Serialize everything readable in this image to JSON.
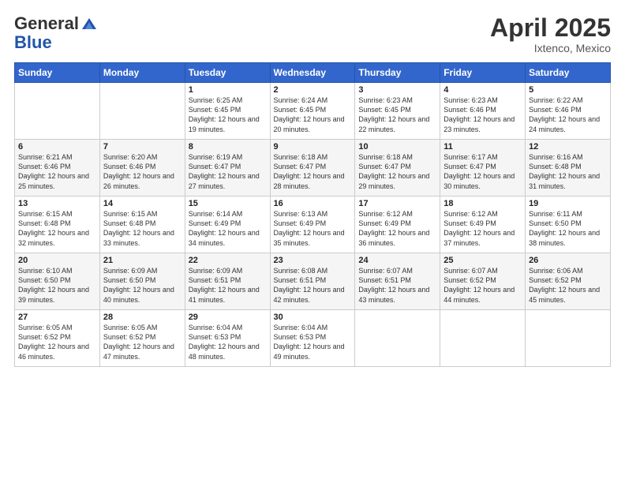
{
  "header": {
    "logo_general": "General",
    "logo_blue": "Blue",
    "title": "April 2025",
    "location": "Ixtenco, Mexico"
  },
  "weekdays": [
    "Sunday",
    "Monday",
    "Tuesday",
    "Wednesday",
    "Thursday",
    "Friday",
    "Saturday"
  ],
  "weeks": [
    [
      {
        "day": "",
        "info": ""
      },
      {
        "day": "",
        "info": ""
      },
      {
        "day": "1",
        "info": "Sunrise: 6:25 AM\nSunset: 6:45 PM\nDaylight: 12 hours and 19 minutes."
      },
      {
        "day": "2",
        "info": "Sunrise: 6:24 AM\nSunset: 6:45 PM\nDaylight: 12 hours and 20 minutes."
      },
      {
        "day": "3",
        "info": "Sunrise: 6:23 AM\nSunset: 6:45 PM\nDaylight: 12 hours and 22 minutes."
      },
      {
        "day": "4",
        "info": "Sunrise: 6:23 AM\nSunset: 6:46 PM\nDaylight: 12 hours and 23 minutes."
      },
      {
        "day": "5",
        "info": "Sunrise: 6:22 AM\nSunset: 6:46 PM\nDaylight: 12 hours and 24 minutes."
      }
    ],
    [
      {
        "day": "6",
        "info": "Sunrise: 6:21 AM\nSunset: 6:46 PM\nDaylight: 12 hours and 25 minutes."
      },
      {
        "day": "7",
        "info": "Sunrise: 6:20 AM\nSunset: 6:46 PM\nDaylight: 12 hours and 26 minutes."
      },
      {
        "day": "8",
        "info": "Sunrise: 6:19 AM\nSunset: 6:47 PM\nDaylight: 12 hours and 27 minutes."
      },
      {
        "day": "9",
        "info": "Sunrise: 6:18 AM\nSunset: 6:47 PM\nDaylight: 12 hours and 28 minutes."
      },
      {
        "day": "10",
        "info": "Sunrise: 6:18 AM\nSunset: 6:47 PM\nDaylight: 12 hours and 29 minutes."
      },
      {
        "day": "11",
        "info": "Sunrise: 6:17 AM\nSunset: 6:47 PM\nDaylight: 12 hours and 30 minutes."
      },
      {
        "day": "12",
        "info": "Sunrise: 6:16 AM\nSunset: 6:48 PM\nDaylight: 12 hours and 31 minutes."
      }
    ],
    [
      {
        "day": "13",
        "info": "Sunrise: 6:15 AM\nSunset: 6:48 PM\nDaylight: 12 hours and 32 minutes."
      },
      {
        "day": "14",
        "info": "Sunrise: 6:15 AM\nSunset: 6:48 PM\nDaylight: 12 hours and 33 minutes."
      },
      {
        "day": "15",
        "info": "Sunrise: 6:14 AM\nSunset: 6:49 PM\nDaylight: 12 hours and 34 minutes."
      },
      {
        "day": "16",
        "info": "Sunrise: 6:13 AM\nSunset: 6:49 PM\nDaylight: 12 hours and 35 minutes."
      },
      {
        "day": "17",
        "info": "Sunrise: 6:12 AM\nSunset: 6:49 PM\nDaylight: 12 hours and 36 minutes."
      },
      {
        "day": "18",
        "info": "Sunrise: 6:12 AM\nSunset: 6:49 PM\nDaylight: 12 hours and 37 minutes."
      },
      {
        "day": "19",
        "info": "Sunrise: 6:11 AM\nSunset: 6:50 PM\nDaylight: 12 hours and 38 minutes."
      }
    ],
    [
      {
        "day": "20",
        "info": "Sunrise: 6:10 AM\nSunset: 6:50 PM\nDaylight: 12 hours and 39 minutes."
      },
      {
        "day": "21",
        "info": "Sunrise: 6:09 AM\nSunset: 6:50 PM\nDaylight: 12 hours and 40 minutes."
      },
      {
        "day": "22",
        "info": "Sunrise: 6:09 AM\nSunset: 6:51 PM\nDaylight: 12 hours and 41 minutes."
      },
      {
        "day": "23",
        "info": "Sunrise: 6:08 AM\nSunset: 6:51 PM\nDaylight: 12 hours and 42 minutes."
      },
      {
        "day": "24",
        "info": "Sunrise: 6:07 AM\nSunset: 6:51 PM\nDaylight: 12 hours and 43 minutes."
      },
      {
        "day": "25",
        "info": "Sunrise: 6:07 AM\nSunset: 6:52 PM\nDaylight: 12 hours and 44 minutes."
      },
      {
        "day": "26",
        "info": "Sunrise: 6:06 AM\nSunset: 6:52 PM\nDaylight: 12 hours and 45 minutes."
      }
    ],
    [
      {
        "day": "27",
        "info": "Sunrise: 6:05 AM\nSunset: 6:52 PM\nDaylight: 12 hours and 46 minutes."
      },
      {
        "day": "28",
        "info": "Sunrise: 6:05 AM\nSunset: 6:52 PM\nDaylight: 12 hours and 47 minutes."
      },
      {
        "day": "29",
        "info": "Sunrise: 6:04 AM\nSunset: 6:53 PM\nDaylight: 12 hours and 48 minutes."
      },
      {
        "day": "30",
        "info": "Sunrise: 6:04 AM\nSunset: 6:53 PM\nDaylight: 12 hours and 49 minutes."
      },
      {
        "day": "",
        "info": ""
      },
      {
        "day": "",
        "info": ""
      },
      {
        "day": "",
        "info": ""
      }
    ]
  ]
}
